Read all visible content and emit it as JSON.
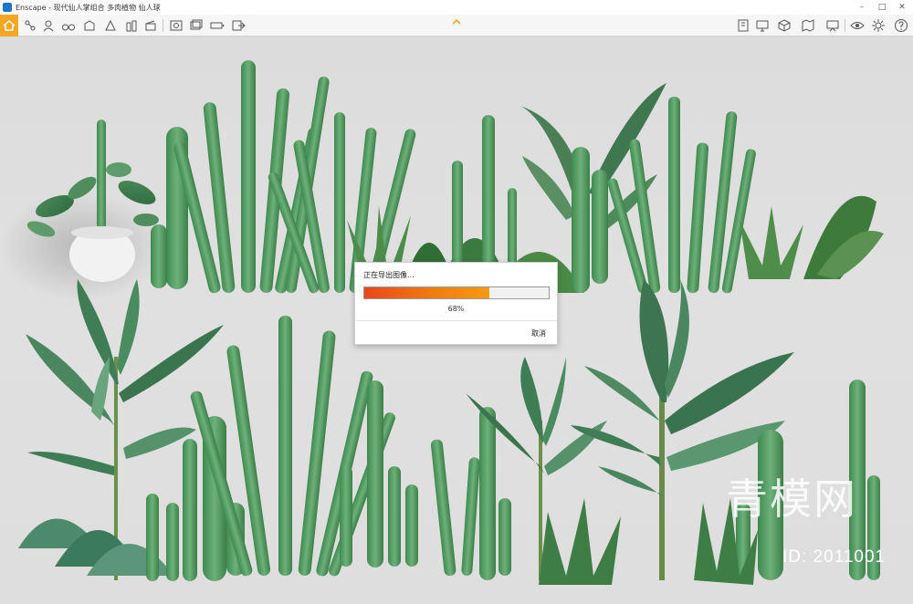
{
  "window": {
    "title": "Enscape - 现代仙人掌组合 多肉植物 仙人球",
    "controls": [
      "minimize",
      "maximize",
      "close"
    ]
  },
  "toolbar": {
    "left_icons": [
      "home-icon",
      "walk-mode-icon",
      "views-icon",
      "binoculars-icon",
      "asset-library-icon",
      "map-marker-icon",
      "buildings-icon",
      "clapper-icon",
      "screenshot-icon",
      "batch-render-icon",
      "panorama-icon",
      "export-icon"
    ],
    "right_icons": [
      "bookmark-icon",
      "monitor-icon",
      "cube-icon",
      "atlas-icon",
      "presentation-icon",
      "eye-icon",
      "gear-icon",
      "help-icon"
    ]
  },
  "dialog": {
    "title": "正在导出图像...",
    "progress": 0.68,
    "progress_text": "68%",
    "cancel_label": "取消"
  },
  "watermark": {
    "logo_text": "青模网",
    "id_text": "ID: 2011001"
  },
  "colors": {
    "accent": "#f5a623",
    "progress_start": "#e8471c",
    "progress_end": "#f69a10",
    "viewport_bg": "#dedede"
  }
}
